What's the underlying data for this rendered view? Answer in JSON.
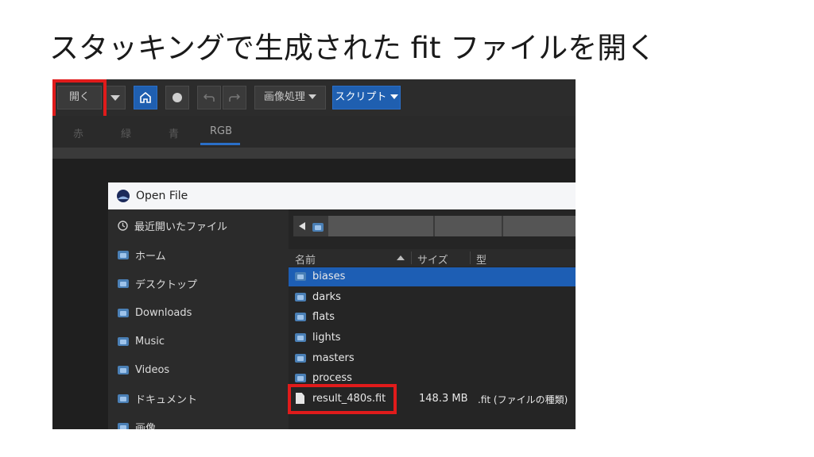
{
  "slide": {
    "title": "スタッキングで生成された fit ファイルを開く"
  },
  "toolbar": {
    "open_label": "開く",
    "image_processing_label": "画像処理",
    "script_label": "スクリプト"
  },
  "channels": {
    "red": "赤",
    "green": "緑",
    "blue": "青",
    "rgb": "RGB"
  },
  "dialog": {
    "title": "Open File",
    "sidebar": {
      "items": [
        {
          "label": "最近開いたファイル",
          "icon": "clock-icon"
        },
        {
          "label": "ホーム",
          "icon": "home-folder-icon"
        },
        {
          "label": "デスクトップ",
          "icon": "desktop-folder-icon"
        },
        {
          "label": "Downloads",
          "icon": "downloads-folder-icon"
        },
        {
          "label": "Music",
          "icon": "music-folder-icon"
        },
        {
          "label": "Videos",
          "icon": "videos-folder-icon"
        },
        {
          "label": "ドキュメント",
          "icon": "documents-folder-icon"
        },
        {
          "label": "画像",
          "icon": "pictures-folder-icon"
        }
      ]
    },
    "columns": {
      "name": "名前",
      "size": "サイズ",
      "type": "型"
    },
    "files": [
      {
        "name": "biases",
        "size": "",
        "type": "",
        "kind": "folder",
        "selected": true
      },
      {
        "name": "darks",
        "size": "",
        "type": "",
        "kind": "folder"
      },
      {
        "name": "flats",
        "size": "",
        "type": "",
        "kind": "folder"
      },
      {
        "name": "lights",
        "size": "",
        "type": "",
        "kind": "folder"
      },
      {
        "name": "masters",
        "size": "",
        "type": "",
        "kind": "folder"
      },
      {
        "name": "process",
        "size": "",
        "type": "",
        "kind": "folder"
      },
      {
        "name": "result_480s.fit",
        "size": "148.3 MB",
        "type": ".fit (ファイルの種類)",
        "kind": "file"
      }
    ]
  },
  "colors": {
    "accent": "#1f5fb0",
    "highlight": "#e01b1b"
  }
}
